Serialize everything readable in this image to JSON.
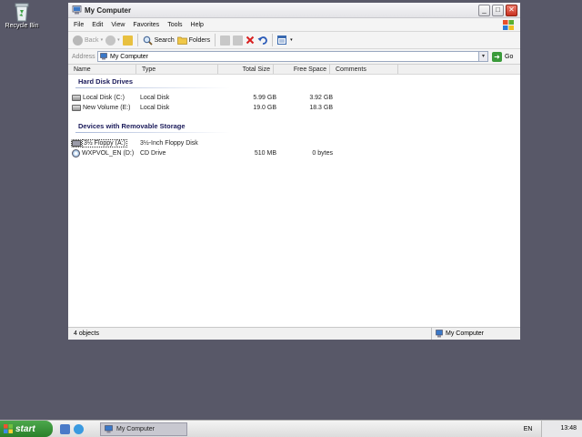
{
  "desktop": {
    "recycle_bin_label": "Recycle Bin"
  },
  "window": {
    "title": "My Computer",
    "controls": {
      "minimize": "_",
      "maximize": "□",
      "close": "✕"
    }
  },
  "menubar": {
    "items": [
      {
        "label": "File"
      },
      {
        "label": "Edit"
      },
      {
        "label": "View"
      },
      {
        "label": "Favorites"
      },
      {
        "label": "Tools"
      },
      {
        "label": "Help"
      }
    ]
  },
  "toolbar": {
    "back_label": "Back",
    "search_label": "Search",
    "folders_label": "Folders"
  },
  "address": {
    "label": "Address",
    "value": "My Computer",
    "go_label": "Go"
  },
  "columns": {
    "name": "Name",
    "type": "Type",
    "total_size": "Total Size",
    "free_space": "Free Space",
    "comments": "Comments"
  },
  "groups": {
    "hard_disks": "Hard Disk Drives",
    "removable": "Devices with Removable Storage"
  },
  "drives": [
    {
      "name": "Local Disk (C:)",
      "type": "Local Disk",
      "total": "5.99 GB",
      "free": "3.92 GB"
    },
    {
      "name": "New Volume (E:)",
      "type": "Local Disk",
      "total": "19.0 GB",
      "free": "18.3 GB"
    },
    {
      "name": "3½ Floppy (A:)",
      "type": "3½-Inch Floppy Disk",
      "total": "",
      "free": ""
    },
    {
      "name": "WXPVOL_EN (D:)",
      "type": "CD Drive",
      "total": "510 MB",
      "free": "0 bytes"
    }
  ],
  "status": {
    "objects": "4 objects",
    "location": "My Computer"
  },
  "taskbar": {
    "start_label": "start",
    "task_label": "My Computer",
    "language": "EN",
    "clock": "13:48"
  },
  "colors": {
    "desktop": "#585868",
    "start_green": "#3a963a",
    "group_text": "#1a1a5a"
  }
}
